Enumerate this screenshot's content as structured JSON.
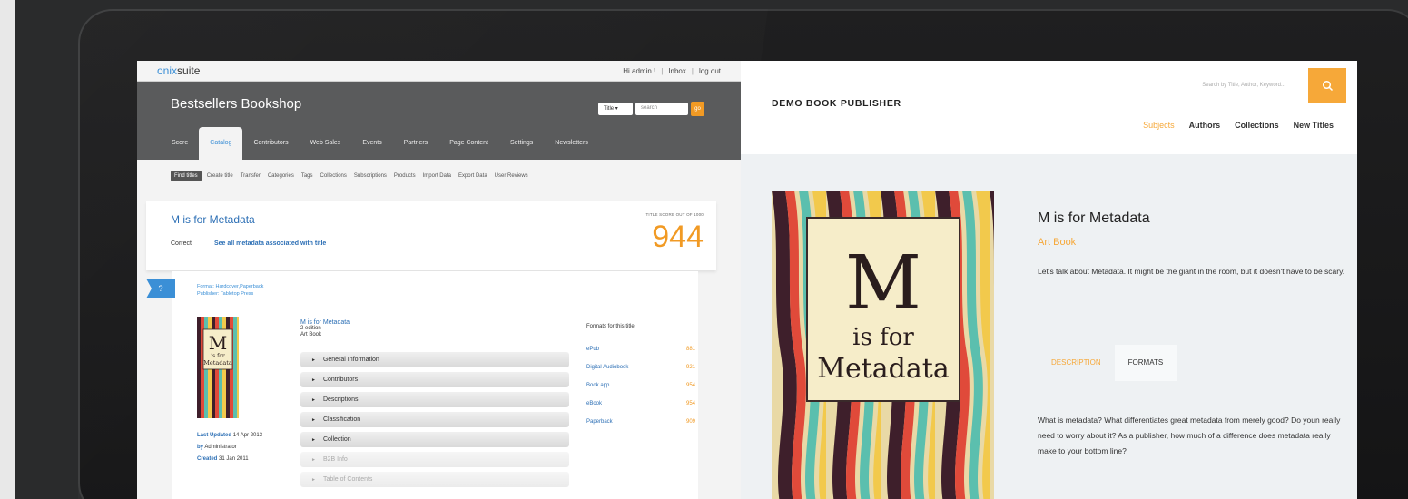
{
  "app": {
    "logo_prefix": "onix",
    "logo_suffix": "suite",
    "user_links": [
      "Hi admin !",
      "Inbox",
      "log out"
    ],
    "store_title": "Bestsellers Bookshop",
    "search": {
      "field": "Title",
      "placeholder": "search",
      "go": "go"
    },
    "tabs": [
      "Score",
      "Catalog",
      "Contributors",
      "Web Sales",
      "Events",
      "Partners",
      "Page Content",
      "Settings",
      "Newsletters"
    ],
    "active_tab": "Catalog",
    "subnav": [
      "Find titles",
      "Create title",
      "Transfer",
      "Categories",
      "Tags",
      "Collections",
      "Subscriptions",
      "Products",
      "Import Data",
      "Export Data",
      "User Reviews"
    ],
    "title_card": {
      "title": "M is for Metadata",
      "correct": "Correct",
      "see_all": "See all metadata associated with title",
      "score_label": "TITLE SCORE OUT OF 1000",
      "score": "944"
    },
    "help": "?",
    "format_line": "Format: Hardcover,Paperback",
    "publisher_line": "Publisher: Tabletop Press",
    "mini_cover": {
      "line1": "M",
      "line2": "is for",
      "line3": "Metadata"
    },
    "meta": {
      "updated_label": "Last Updated",
      "updated": "14 Apr 2013",
      "by_label": "by",
      "by": "Administrator",
      "created_label": "Created",
      "created": "31 Jan 2011"
    },
    "book_info": {
      "title": "M is for Metadata",
      "edition": "2 edition",
      "type": "Art Book"
    },
    "accordion": [
      {
        "label": "General Information",
        "dim": false
      },
      {
        "label": "Contributors",
        "dim": false
      },
      {
        "label": "Descriptions",
        "dim": false
      },
      {
        "label": "Classification",
        "dim": false
      },
      {
        "label": "Collection",
        "dim": false
      },
      {
        "label": "B2B Info",
        "dim": true
      },
      {
        "label": "Table of Contents",
        "dim": true
      }
    ],
    "formats_header": "Formats for this title:",
    "formats": [
      {
        "name": "ePub",
        "score": "881"
      },
      {
        "name": "Digital Audiobook",
        "score": "921"
      },
      {
        "name": "Book app",
        "score": "954"
      },
      {
        "name": "eBook",
        "score": "954"
      },
      {
        "name": "Paperback",
        "score": "909"
      }
    ]
  },
  "site": {
    "brand": "DEMO BOOK PUBLISHER",
    "search_placeholder": "Search by Title, Author, Keyword...",
    "nav": [
      "Subjects",
      "Authors",
      "Collections",
      "New Titles"
    ],
    "active_nav": "Subjects",
    "cover": {
      "line1": "M",
      "line2": "is for",
      "line3": "Metadata"
    },
    "title": "M is for Metadata",
    "genre": "Art Book",
    "blurb": "Let's talk about Metadata. It might be the giant in the room, but it doesn't have to be scary.",
    "tabs": [
      "DESCRIPTION",
      "FORMATS"
    ],
    "description": "What is metadata? What differentiates great metadata from merely good? Do youn really need to worry about it? As a publisher, how much of a difference does metadata really make to your bottom line?"
  },
  "colors": {
    "accent_orange": "#f6a839",
    "link_blue": "#2c6fb5",
    "header_gray": "#5a5b5c"
  }
}
